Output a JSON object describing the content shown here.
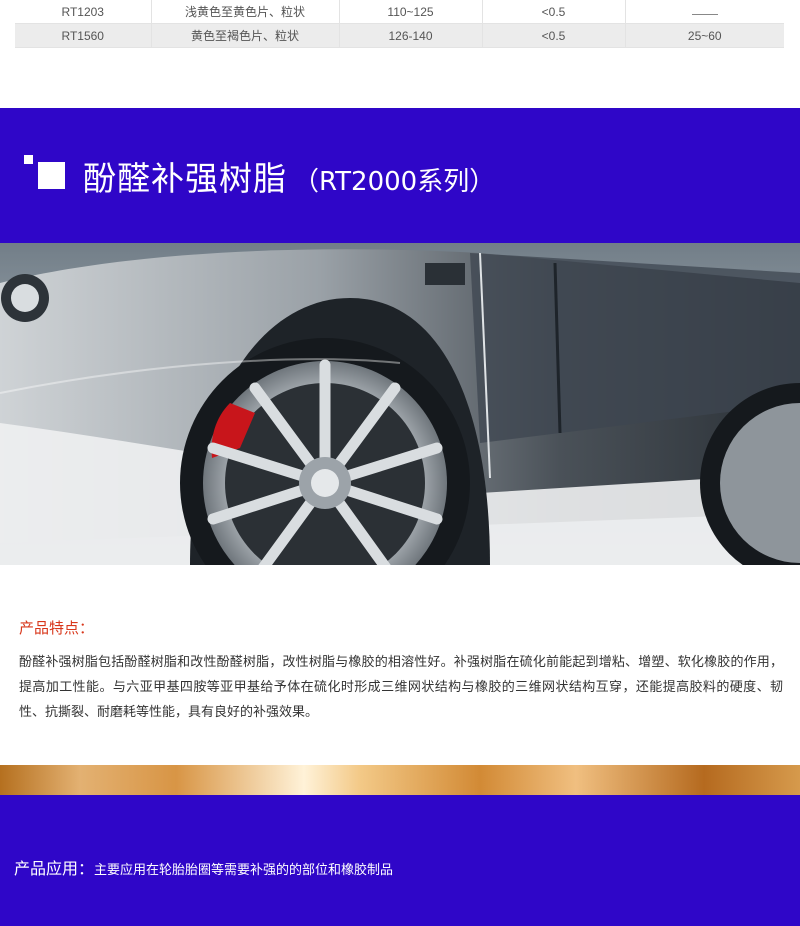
{
  "spec_table": {
    "rows": [
      {
        "grade": "RT1203",
        "appearance": "浅黄色至黄色片、粒状",
        "softening_point": "110~125",
        "ash": "<0.5",
        "extra": "",
        "extra_dash": true
      },
      {
        "grade": "RT1560",
        "appearance": "黄色至褐色片、粒状",
        "softening_point": "126-140",
        "ash": "<0.5",
        "extra": "25~60",
        "extra_dash": false
      }
    ]
  },
  "title": {
    "main": "酚醛补强树脂",
    "sub": "（RT2000系列）"
  },
  "features": {
    "heading": "产品特点：",
    "body": "酚醛补强树脂包括酚醛树脂和改性酚醛树脂，改性树脂与橡胶的相溶性好。补强树脂在硫化前能起到增粘、增塑、软化橡胶的作用，提高加工性能。与六亚甲基四胺等亚甲基给予体在硫化时形成三维网状结构与橡胶的三维网状结构互穿，还能提高胶料的硬度、韧性、抗撕裂、耐磨耗等性能，具有良好的补强效果。"
  },
  "application": {
    "label": "产品应用：",
    "value": "主要应用在轮胎胎圈等需要补强的的部位和橡胶制品"
  },
  "colors": {
    "brand_blue": "#2f06c8",
    "heading_red": "#d8361a"
  }
}
